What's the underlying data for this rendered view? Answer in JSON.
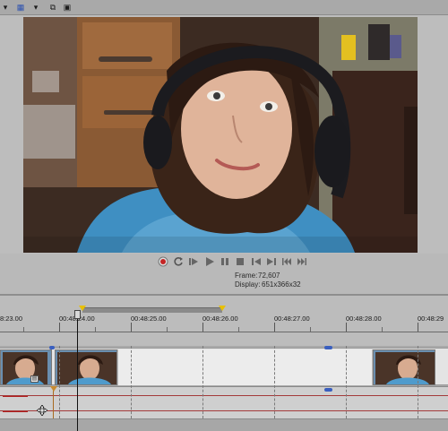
{
  "toolbar": {
    "items": [
      {
        "name": "dropdown-arrow-icon",
        "glyph": "▾"
      },
      {
        "name": "grid-icon",
        "glyph": "▦"
      },
      {
        "name": "dropdown-arrow-icon",
        "glyph": "▾"
      },
      {
        "name": "copy-icon",
        "glyph": "⧉"
      },
      {
        "name": "save-icon",
        "glyph": "▣"
      }
    ]
  },
  "transport": {
    "buttons": [
      {
        "name": "record-button",
        "icon": "record-icon"
      },
      {
        "name": "loop-playback-button",
        "icon": "loop-icon"
      },
      {
        "name": "play-from-start-button",
        "icon": "play-from-start-icon"
      },
      {
        "name": "play-button",
        "icon": "play-icon"
      },
      {
        "name": "pause-button",
        "icon": "pause-icon"
      },
      {
        "name": "stop-button",
        "icon": "stop-icon"
      },
      {
        "name": "go-to-start-button",
        "icon": "go-to-start-icon"
      },
      {
        "name": "go-to-end-button",
        "icon": "go-to-end-icon"
      },
      {
        "name": "previous-frame-button",
        "icon": "previous-frame-icon"
      },
      {
        "name": "next-frame-button",
        "icon": "next-frame-icon"
      }
    ]
  },
  "preview": {
    "frame_label": "Frame:",
    "frame_value": "72,607",
    "display_label": "Display:",
    "display_value": "651x366x32"
  },
  "timeline": {
    "timecodes": [
      "8:23.00",
      "00:48:24.00",
      "00:48:25.00",
      "00:48:26.00",
      "00:48:27.00",
      "00:48:28.00",
      "00:48:29"
    ]
  },
  "colors": {
    "accent_yellow": "#e8c000",
    "envelope_red": "#a33a3a",
    "fx_blue": "#3a5fbf"
  }
}
